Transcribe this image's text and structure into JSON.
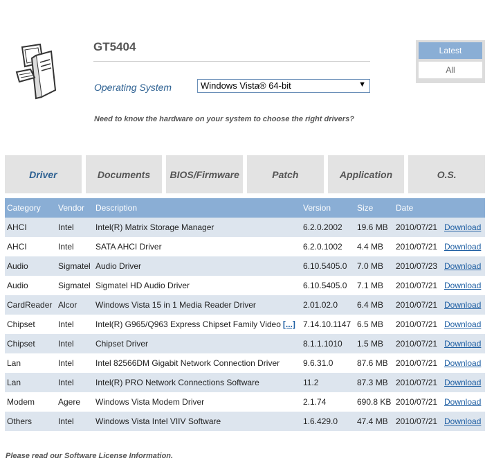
{
  "header": {
    "model": "GT5404",
    "os_label": "Operating System",
    "os_selected": "Windows Vista® 64-bit",
    "hint": "Need to know the hardware on your system to choose the right drivers?"
  },
  "filter": {
    "latest": "Latest",
    "all": "All"
  },
  "tabs": [
    "Driver",
    "Documents",
    "BIOS/Firmware",
    "Patch",
    "Application",
    "O.S."
  ],
  "table": {
    "columns": [
      "Category",
      "Vendor",
      "Description",
      "Version",
      "Size",
      "Date",
      ""
    ],
    "download_label": "Download",
    "more_label": "[...]",
    "rows": [
      [
        "AHCI",
        "Intel",
        "Intel(R) Matrix Storage Manager",
        "6.2.0.2002",
        "19.6 MB",
        "2010/07/21"
      ],
      [
        "AHCI",
        "Intel",
        "SATA AHCI Driver",
        "6.2.0.1002",
        "4.4 MB",
        "2010/07/21"
      ],
      [
        "Audio",
        "Sigmatel",
        "Audio Driver",
        "6.10.5405.0",
        "7.0 MB",
        "2010/07/23"
      ],
      [
        "Audio",
        "Sigmatel",
        "Sigmatel HD Audio Driver",
        "6.10.5405.0",
        "7.1 MB",
        "2010/07/21"
      ],
      [
        "CardReader",
        "Alcor",
        "Windows Vista 15 in 1 Media Reader Driver",
        "2.01.02.0",
        "6.4 MB",
        "2010/07/21"
      ],
      [
        "Chipset",
        "Intel",
        "Intel(R) G965/Q963 Express Chipset Family Video",
        "7.14.10.1147",
        "6.5 MB",
        "2010/07/21"
      ],
      [
        "Chipset",
        "Intel",
        "Chipset Driver",
        "8.1.1.1010",
        "1.5 MB",
        "2010/07/21"
      ],
      [
        "Lan",
        "Intel",
        "Intel 82566DM Gigabit Network Connection Driver",
        "9.6.31.0",
        "87.6 MB",
        "2010/07/21"
      ],
      [
        "Lan",
        "Intel",
        "Intel(R) PRO Network Connections Software",
        "11.2",
        "87.3 MB",
        "2010/07/21"
      ],
      [
        "Modem",
        "Agere",
        "Windows Vista Modem Driver",
        "2.1.74",
        "690.8 KB",
        "2010/07/21"
      ],
      [
        "Others",
        "Intel",
        "Windows Vista Intel VIIV Software",
        "1.6.429.0",
        "47.4 MB",
        "2010/07/21"
      ]
    ]
  },
  "footer": {
    "note": "Please read our Software License Information."
  },
  "colors": {
    "accent_blue": "#8aaed5",
    "link_blue": "#1f5fa3",
    "row_alt": "#dde5ee",
    "tab_bg": "#e3e3e3"
  }
}
